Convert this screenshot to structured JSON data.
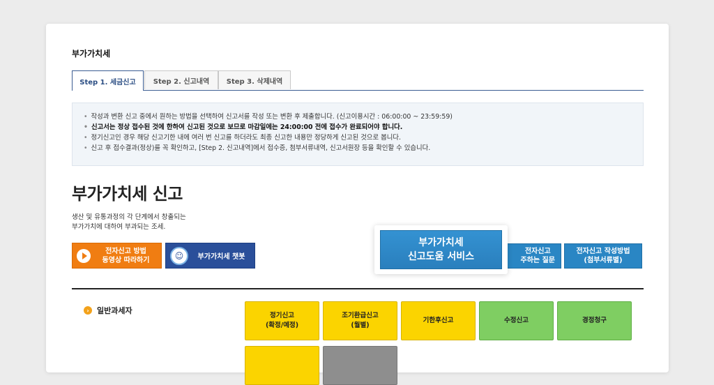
{
  "section_title": "부가가치세",
  "tabs": [
    {
      "label": "Step 1. 세금신고",
      "active": true
    },
    {
      "label": "Step 2. 신고내역",
      "active": false
    },
    {
      "label": "Step 3. 삭제내역",
      "active": false
    }
  ],
  "notice": [
    "작성과 변환 신고 중에서 원하는 방법을 선택하여 신고서를 작성 또는 변환 후 제출합니다. (신고이용시간 : 06:00:00 ~ 23:59:59)",
    "신고서는 정상 접수된 것에 한하여 신고된 것으로 보므로 마감일에는 24:00:00 전에 접수가 완료되어야 합니다.",
    "정기신고인 경우 해당 신고기한 내에 여러 번 신고를 하더라도 최종 신고한 내용만 정당하게 신고된 것으로 봅니다.",
    "신고 후 접수결과(정상)를 꼭 확인하고, [Step 2. 신고내역]에서 접수증, 첨부서류내역, 신고서원장 등을 확인할 수 있습니다."
  ],
  "main": {
    "title": "부가가치세 신고",
    "desc_line1": "생산 및 유통과정의 각 단계에서 창출되는",
    "desc_line2": "부가가치에 대하여 부과되는 조세."
  },
  "buttons": {
    "video_line1": "전자신고 방법",
    "video_line2": "동영상 따라하기",
    "chatbot": "부가가치세 챗봇",
    "help_line1": "부가가치세",
    "help_line2": "신고도움 서비스",
    "faq_line1": "전자신고",
    "faq_line2": "주하는 질문",
    "guide_line1": "전자신고 작성방법",
    "guide_line2": "(첨부서류별)"
  },
  "category": {
    "label": "일반과세자"
  },
  "tiles": [
    {
      "line1": "정기신고",
      "line2": "(확정/예정)",
      "color": "yellow"
    },
    {
      "line1": "조기환급신고",
      "line2": "(월별)",
      "color": "yellow"
    },
    {
      "line1": "기한후신고",
      "line2": "",
      "color": "yellow"
    },
    {
      "line1": "수정신고",
      "line2": "",
      "color": "green"
    },
    {
      "line1": "경정청구",
      "line2": "",
      "color": "green"
    }
  ],
  "colors": {
    "accent_blue": "#2a86c4",
    "tab_navy": "#3a5c91",
    "orange": "#f07d12",
    "yellow": "#fbd400",
    "green": "#7fce62"
  }
}
